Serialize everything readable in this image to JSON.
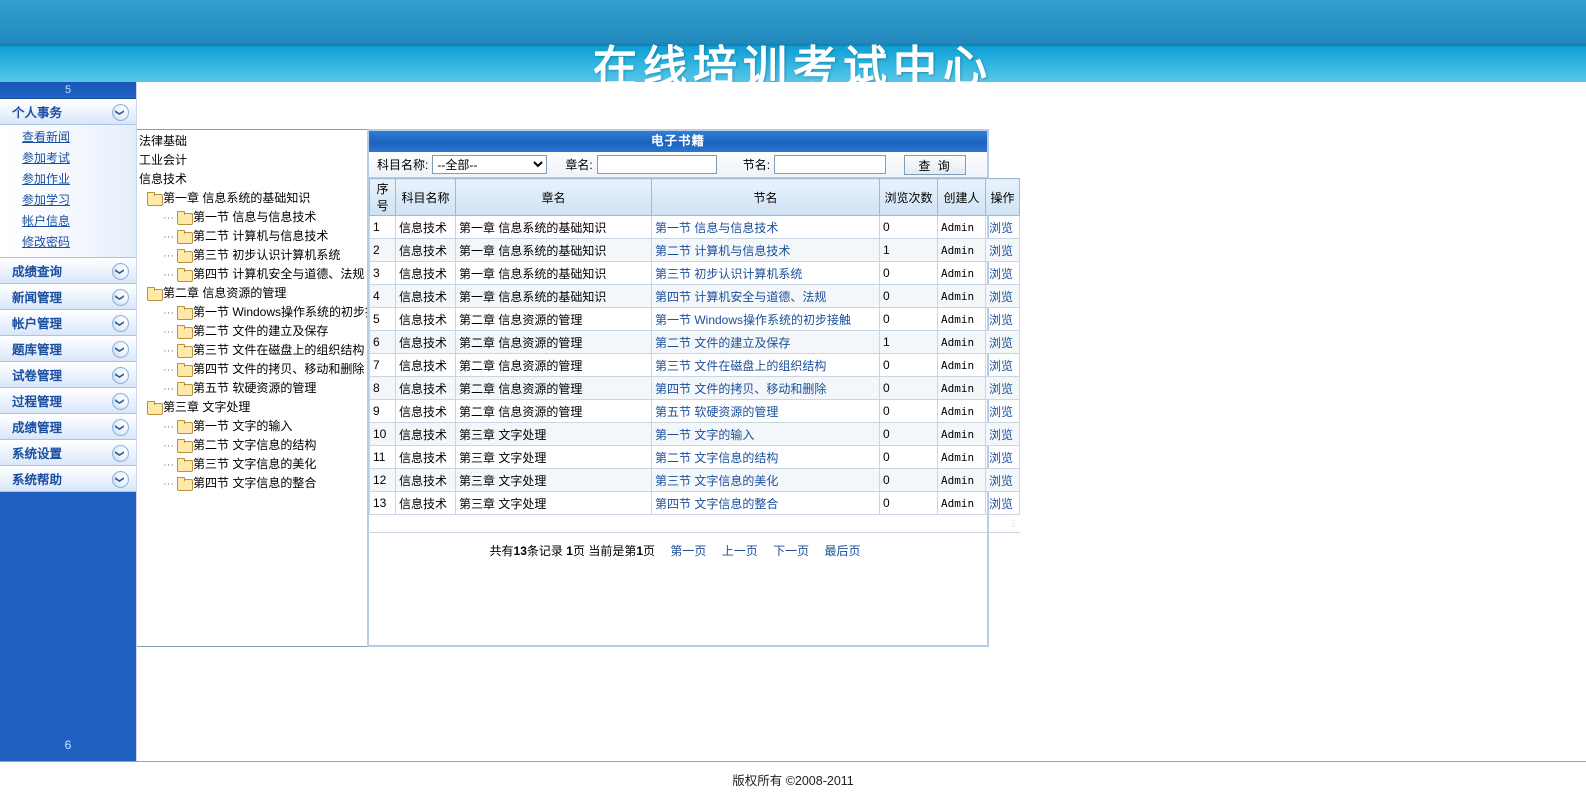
{
  "banner": {
    "title": "在线培训考试中心"
  },
  "sidebar": {
    "top_label": "5",
    "bottom_label": "6",
    "chevron_icon": "chevron-down-icon",
    "groups": [
      {
        "label": "个人事务",
        "expanded": true,
        "links": [
          "查看新闻",
          "参加考试",
          "参加作业",
          "参加学习",
          "帐户信息",
          "修改密码"
        ]
      },
      {
        "label": "成绩查询",
        "expanded": false,
        "links": []
      },
      {
        "label": "新闻管理",
        "expanded": false,
        "links": []
      },
      {
        "label": "帐户管理",
        "expanded": false,
        "links": []
      },
      {
        "label": "题库管理",
        "expanded": false,
        "links": []
      },
      {
        "label": "试卷管理",
        "expanded": false,
        "links": []
      },
      {
        "label": "过程管理",
        "expanded": false,
        "links": []
      },
      {
        "label": "成绩管理",
        "expanded": false,
        "links": []
      },
      {
        "label": "系统设置",
        "expanded": false,
        "links": []
      },
      {
        "label": "系统帮助",
        "expanded": false,
        "links": []
      }
    ]
  },
  "tree": {
    "roots": [
      {
        "level": 0,
        "label": "法律基础",
        "folder": false
      },
      {
        "level": 0,
        "label": "工业会计",
        "folder": false
      },
      {
        "level": 0,
        "label": "信息技术",
        "folder": false
      },
      {
        "level": 1,
        "label": "第一章 信息系统的基础知识",
        "folder": true
      },
      {
        "level": 2,
        "label": "第一节 信息与信息技术",
        "folder": true
      },
      {
        "level": 2,
        "label": "第二节 计算机与信息技术",
        "folder": true
      },
      {
        "level": 2,
        "label": "第三节 初步认识计算机系统",
        "folder": true
      },
      {
        "level": 2,
        "label": "第四节 计算机安全与道德、法规",
        "folder": true
      },
      {
        "level": 1,
        "label": "第二章 信息资源的管理",
        "folder": true
      },
      {
        "level": 2,
        "label": "第一节 Windows操作系统的初步接触",
        "folder": true
      },
      {
        "level": 2,
        "label": "第二节 文件的建立及保存",
        "folder": true
      },
      {
        "level": 2,
        "label": "第三节 文件在磁盘上的组织结构",
        "folder": true
      },
      {
        "level": 2,
        "label": "第四节 文件的拷贝、移动和删除",
        "folder": true
      },
      {
        "level": 2,
        "label": "第五节 软硬资源的管理",
        "folder": true
      },
      {
        "level": 1,
        "label": "第三章 文字处理",
        "folder": true
      },
      {
        "level": 2,
        "label": "第一节 文字的输入",
        "folder": true
      },
      {
        "level": 2,
        "label": "第二节 文字信息的结构",
        "folder": true
      },
      {
        "level": 2,
        "label": "第三节 文字信息的美化",
        "folder": true
      },
      {
        "level": 2,
        "label": "第四节 文字信息的整合",
        "folder": true
      }
    ]
  },
  "panel": {
    "title": "电子书籍",
    "search": {
      "subject_label": "科目名称:",
      "subject_value": "--全部--",
      "subject_options": [
        "--全部--",
        "法律基础",
        "工业会计",
        "信息技术"
      ],
      "chapter_label": "章名:",
      "chapter_value": "",
      "chapter_placeholder": "",
      "section_label": "节名:",
      "section_value": "",
      "section_placeholder": "",
      "query_button": "查 询"
    },
    "columns": [
      "序号",
      "科目名称",
      "章名",
      "节名",
      "浏览次数",
      "创建人",
      "操作"
    ],
    "rows": [
      {
        "idx": "1",
        "subject": "信息技术",
        "chapter": "第一章 信息系统的基础知识",
        "section": "第一节 信息与信息技术",
        "views": "0",
        "creator": "Admin",
        "op": "浏览"
      },
      {
        "idx": "2",
        "subject": "信息技术",
        "chapter": "第一章 信息系统的基础知识",
        "section": "第二节 计算机与信息技术",
        "views": "1",
        "creator": "Admin",
        "op": "浏览"
      },
      {
        "idx": "3",
        "subject": "信息技术",
        "chapter": "第一章 信息系统的基础知识",
        "section": "第三节 初步认识计算机系统",
        "views": "0",
        "creator": "Admin",
        "op": "浏览"
      },
      {
        "idx": "4",
        "subject": "信息技术",
        "chapter": "第一章 信息系统的基础知识",
        "section": "第四节 计算机安全与道德、法规",
        "views": "0",
        "creator": "Admin",
        "op": "浏览"
      },
      {
        "idx": "5",
        "subject": "信息技术",
        "chapter": "第二章 信息资源的管理",
        "section": "第一节 Windows操作系统的初步接触",
        "views": "0",
        "creator": "Admin",
        "op": "浏览"
      },
      {
        "idx": "6",
        "subject": "信息技术",
        "chapter": "第二章 信息资源的管理",
        "section": "第二节 文件的建立及保存",
        "views": "1",
        "creator": "Admin",
        "op": "浏览"
      },
      {
        "idx": "7",
        "subject": "信息技术",
        "chapter": "第二章 信息资源的管理",
        "section": "第三节 文件在磁盘上的组织结构",
        "views": "0",
        "creator": "Admin",
        "op": "浏览"
      },
      {
        "idx": "8",
        "subject": "信息技术",
        "chapter": "第二章 信息资源的管理",
        "section": "第四节 文件的拷贝、移动和删除",
        "views": "0",
        "creator": "Admin",
        "op": "浏览"
      },
      {
        "idx": "9",
        "subject": "信息技术",
        "chapter": "第二章 信息资源的管理",
        "section": "第五节 软硬资源的管理",
        "views": "0",
        "creator": "Admin",
        "op": "浏览"
      },
      {
        "idx": "10",
        "subject": "信息技术",
        "chapter": "第三章 文字处理",
        "section": "第一节 文字的输入",
        "views": "0",
        "creator": "Admin",
        "op": "浏览"
      },
      {
        "idx": "11",
        "subject": "信息技术",
        "chapter": "第三章 文字处理",
        "section": "第二节 文字信息的结构",
        "views": "0",
        "creator": "Admin",
        "op": "浏览"
      },
      {
        "idx": "12",
        "subject": "信息技术",
        "chapter": "第三章 文字处理",
        "section": "第三节 文字信息的美化",
        "views": "0",
        "creator": "Admin",
        "op": "浏览"
      },
      {
        "idx": "13",
        "subject": "信息技术",
        "chapter": "第三章 文字处理",
        "section": "第四节 文字信息的整合",
        "views": "0",
        "creator": "Admin",
        "op": "浏览"
      }
    ],
    "tail_page_number": "1",
    "pager": {
      "total_prefix": "共有",
      "total_count": "13",
      "total_suffix": "条记录",
      "pages_count": "1",
      "pages_suffix": "页",
      "current_prefix": "当前是第",
      "current_page": "1",
      "current_suffix": "页",
      "first": "第一页",
      "prev": "上一页",
      "next": "下一页",
      "last": "最后页"
    }
  },
  "footer": {
    "copyright": "版权所有 ©2008-2011"
  },
  "colors": {
    "brand_blue": "#1e5fc0",
    "banner_cyan": "#2b9fd0",
    "link_blue": "#1a4f9c",
    "folder_yellow": "#ffe9a8"
  }
}
